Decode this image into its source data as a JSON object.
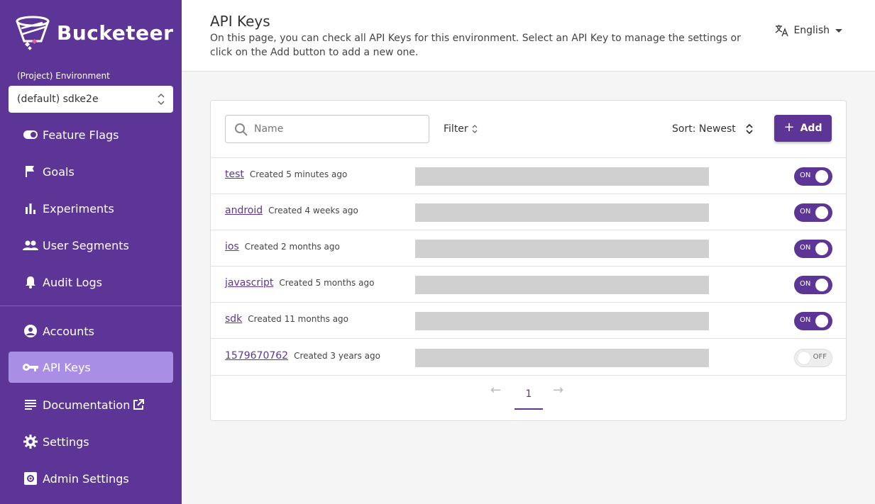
{
  "app": {
    "name": "Bucketeer"
  },
  "environment": {
    "label": "(Project) Environment",
    "value": "(default) sdke2e"
  },
  "nav": {
    "primary": [
      {
        "label": "Feature Flags",
        "icon": "toggle-icon"
      },
      {
        "label": "Goals",
        "icon": "flag-icon"
      },
      {
        "label": "Experiments",
        "icon": "bar-chart-icon"
      },
      {
        "label": "User Segments",
        "icon": "people-icon"
      },
      {
        "label": "Audit Logs",
        "icon": "bell-icon"
      }
    ],
    "secondary": [
      {
        "label": "Accounts",
        "icon": "account-circle-icon"
      },
      {
        "label": "API Keys",
        "icon": "key-icon",
        "active": true
      },
      {
        "label": "Documentation",
        "icon": "document-icon"
      },
      {
        "label": "Settings",
        "icon": "gear-icon"
      },
      {
        "label": "Admin Settings",
        "icon": "admin-gear-icon"
      }
    ]
  },
  "header": {
    "title": "API Keys",
    "description": "On this page, you can check all API Keys for this environment. Select an API Key to manage the settings or click on the Add button to add a new one.",
    "language": "English"
  },
  "toolbar": {
    "search_placeholder": "Name",
    "filter_label": "Filter",
    "sort_label": "Sort: Newest",
    "add_label": "Add"
  },
  "api_keys": [
    {
      "name": "test",
      "created": "Created 5 minutes ago",
      "enabled": true,
      "toggle_label": "ON"
    },
    {
      "name": "android",
      "created": "Created 4 weeks ago",
      "enabled": true,
      "toggle_label": "ON"
    },
    {
      "name": "ios",
      "created": "Created 2 months ago",
      "enabled": true,
      "toggle_label": "ON"
    },
    {
      "name": "javascript",
      "created": "Created 5 months ago",
      "enabled": true,
      "toggle_label": "ON"
    },
    {
      "name": "sdk",
      "created": "Created 11 months ago",
      "enabled": true,
      "toggle_label": "ON"
    },
    {
      "name": "1579670762",
      "created": "Created 3 years ago",
      "enabled": false,
      "toggle_label": "OFF"
    }
  ],
  "pagination": {
    "prev": "←",
    "current": "1",
    "next": "→"
  },
  "colors": {
    "brand": "#5d3597",
    "active_nav": "#a98ee6",
    "key_mask": "#d0d0d0"
  }
}
